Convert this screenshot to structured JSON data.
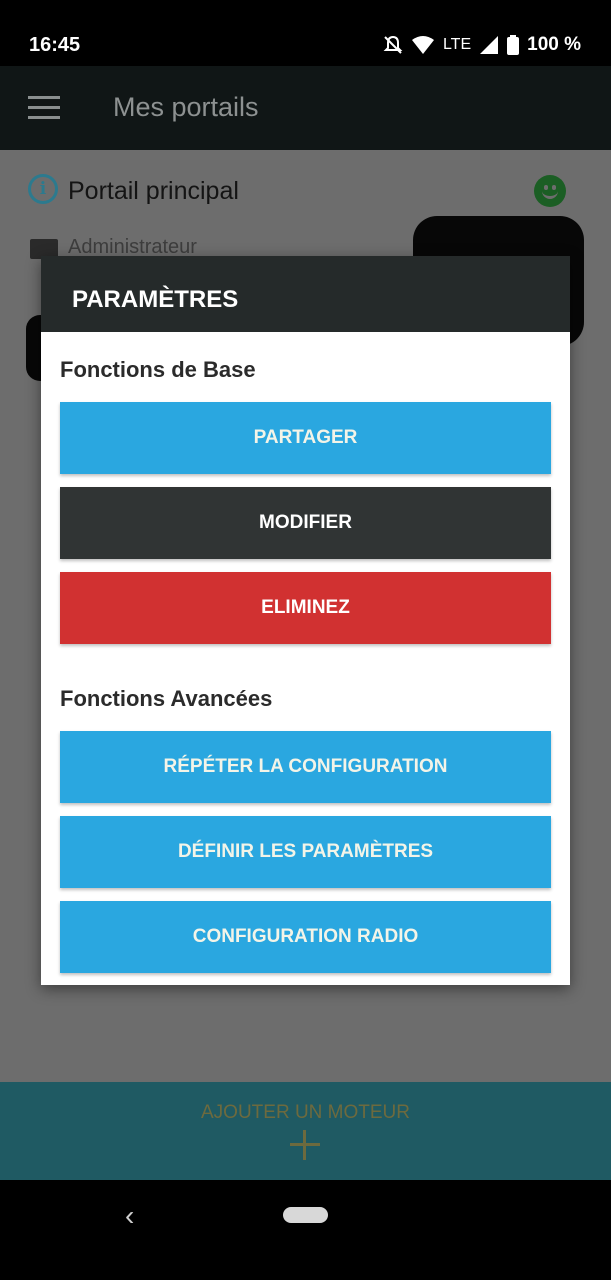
{
  "status_bar": {
    "time": "16:45",
    "network": "LTE",
    "battery": "100 %"
  },
  "app_bar": {
    "title": "Mes portails"
  },
  "portal": {
    "name": "Portail principal",
    "role": "Administrateur"
  },
  "bottom_bar": {
    "add_motor_label": "AJOUTER UN MOTEUR"
  },
  "dialog": {
    "title": "PARAMÈTRES",
    "basic_section": "Fonctions de Base",
    "basic_buttons": [
      "PARTAGER",
      "MODIFIER",
      "ELIMINEZ"
    ],
    "advanced_section": "Fonctions Avancées",
    "advanced_buttons": [
      "RÉPÉTER LA CONFIGURATION",
      "DÉFINIR LES PARAMÈTRES",
      "CONFIGURATION RADIO"
    ]
  },
  "colors": {
    "accent_blue": "#2aa7e0",
    "dark_button": "#303434",
    "danger_red": "#d13131",
    "app_bar": "#101616",
    "bottom_bar": "#1f5a63"
  }
}
